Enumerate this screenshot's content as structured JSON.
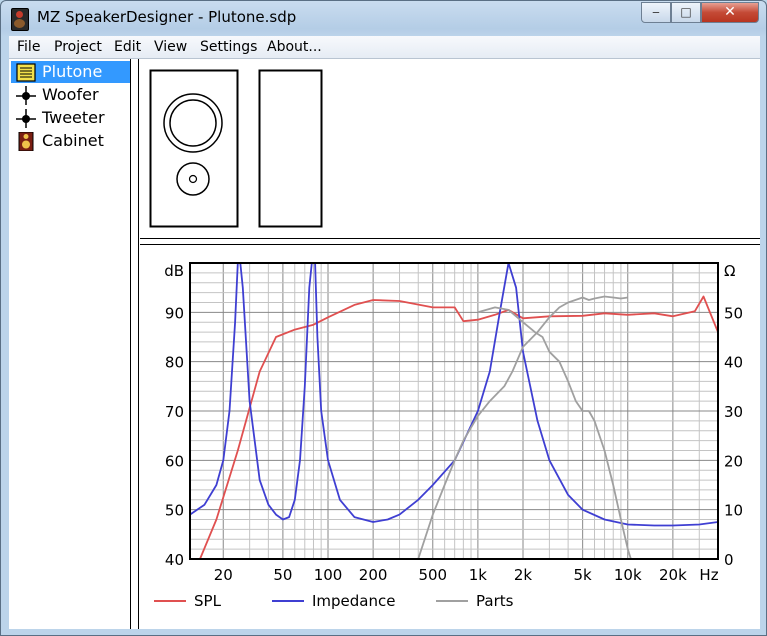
{
  "window": {
    "title": "MZ SpeakerDesigner - Plutone.sdp",
    "minimize_glyph": "‒",
    "maximize_glyph": "□",
    "close_glyph": "✕"
  },
  "menu": [
    "File",
    "Project",
    "Edit",
    "View",
    "Settings",
    "About..."
  ],
  "tree": [
    {
      "label": "Plutone",
      "icon": "project-icon",
      "selected": true
    },
    {
      "label": "Woofer",
      "icon": "driver-node-icon",
      "selected": false
    },
    {
      "label": "Tweeter",
      "icon": "driver-node-icon",
      "selected": false
    },
    {
      "label": "Cabinet",
      "icon": "speaker-cabinet-icon",
      "selected": false
    }
  ],
  "chart_data": {
    "type": "line",
    "x_scale": "log",
    "xlim": [
      12,
      40000
    ],
    "x_ticks": [
      {
        "value": 20,
        "label": "20"
      },
      {
        "value": 50,
        "label": "50"
      },
      {
        "value": 100,
        "label": "100"
      },
      {
        "value": 200,
        "label": "200"
      },
      {
        "value": 500,
        "label": "500"
      },
      {
        "value": 1000,
        "label": "1k"
      },
      {
        "value": 2000,
        "label": "2k"
      },
      {
        "value": 5000,
        "label": "5k"
      },
      {
        "value": 10000,
        "label": "10k"
      },
      {
        "value": 20000,
        "label": "20k"
      }
    ],
    "x_unit_label": "Hz",
    "ylabel_left": "dB",
    "ylabel_right": "Ω",
    "ylim_left": [
      40,
      100
    ],
    "ylim_right": [
      0,
      60
    ],
    "y_ticks_left": [
      40,
      50,
      60,
      70,
      80,
      90
    ],
    "y_ticks_right": [
      0,
      10,
      20,
      30,
      40,
      50
    ],
    "grid": true,
    "legend_position": "bottom",
    "series": [
      {
        "name": "SPL",
        "axis": "left",
        "color": "#e05050",
        "x": [
          14,
          18,
          25,
          35,
          45,
          60,
          80,
          100,
          150,
          200,
          300,
          500,
          700,
          800,
          1000,
          1300,
          1600,
          2000,
          3000,
          5000,
          7000,
          10000,
          15000,
          20000,
          28000,
          32000,
          40000
        ],
        "y": [
          40,
          48,
          62,
          78,
          85,
          86.5,
          87.5,
          89,
          91.5,
          92.5,
          92.3,
          91,
          91,
          88.2,
          88.5,
          89.5,
          90.5,
          88.8,
          89.2,
          89.3,
          89.8,
          89.5,
          89.8,
          89.2,
          90.2,
          93.2,
          86
        ]
      },
      {
        "name": "Impedance",
        "axis": "right",
        "color": "#3f3fd2",
        "x": [
          12,
          15,
          18,
          20,
          22,
          24,
          25,
          26,
          27,
          30,
          35,
          40,
          45,
          50,
          55,
          60,
          65,
          70,
          75,
          78,
          80,
          82,
          85,
          90,
          100,
          120,
          150,
          200,
          250,
          300,
          400,
          500,
          700,
          1000,
          1200,
          1400,
          1600,
          1800,
          2000,
          2500,
          3000,
          4000,
          5000,
          7000,
          10000,
          15000,
          20000,
          30000,
          40000
        ],
        "y": [
          9,
          11,
          15,
          20,
          30,
          48,
          60,
          60,
          55,
          32,
          16,
          11,
          9,
          8,
          8.5,
          12,
          20,
          35,
          55,
          60,
          60,
          60,
          45,
          30,
          20,
          12,
          8.5,
          7.5,
          8,
          9,
          12,
          15,
          20,
          30,
          38,
          50,
          60,
          55,
          42,
          28,
          20,
          13,
          10,
          8,
          7,
          6.8,
          6.8,
          7,
          7.5
        ]
      },
      {
        "name": "Parts",
        "axis": "right",
        "color": "#a0a0a0",
        "x": [
          400,
          500,
          600,
          700,
          800,
          1000,
          1200,
          1500,
          1700,
          2000,
          2500,
          3000,
          3500,
          4000,
          5000,
          5500,
          6000,
          7000,
          8000,
          9000,
          10000
        ],
        "y": [
          0,
          9,
          15,
          20,
          24,
          29,
          32,
          35,
          38,
          43,
          46,
          49,
          51,
          52,
          53,
          52.5,
          52.8,
          53.2,
          53,
          52.8,
          53
        ]
      },
      {
        "name": "",
        "axis": "right",
        "color": "#a0a0a0",
        "x": [
          1000,
          1300,
          1600,
          2000,
          2400,
          2700,
          3000,
          3500,
          4000,
          4500,
          5000,
          5500,
          6000,
          7000,
          8000,
          9000,
          10000,
          10500
        ],
        "y": [
          50,
          51,
          50.5,
          48,
          46,
          45,
          42,
          40,
          36,
          32,
          30,
          30,
          28,
          22,
          15,
          8,
          2,
          0
        ]
      }
    ]
  }
}
